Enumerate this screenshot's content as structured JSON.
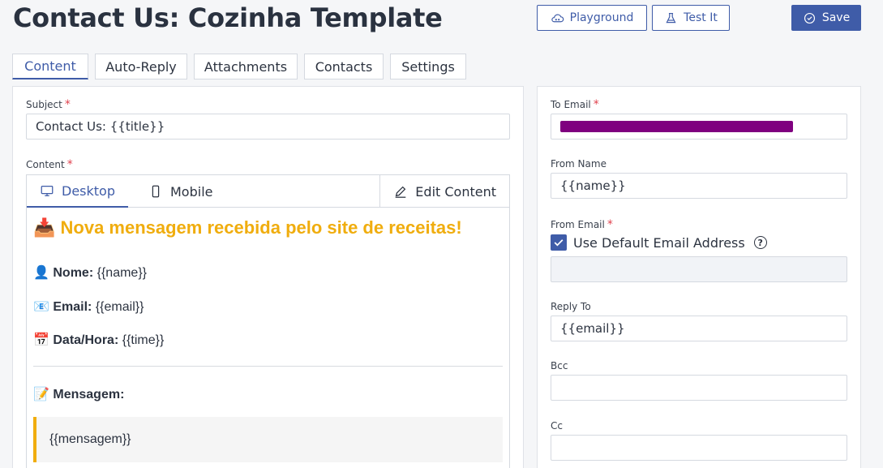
{
  "header": {
    "title": "Contact Us: Cozinha Template",
    "playground_label": "Playground",
    "test_label": "Test It",
    "save_label": "Save"
  },
  "tabs": [
    {
      "label": "Content",
      "active": true
    },
    {
      "label": "Auto-Reply"
    },
    {
      "label": "Attachments"
    },
    {
      "label": "Contacts"
    },
    {
      "label": "Settings"
    }
  ],
  "left": {
    "subject_label": "Subject",
    "subject_value": "Contact Us: {{title}}",
    "content_label": "Content",
    "editor_tabs": {
      "desktop": "Desktop",
      "mobile": "Mobile",
      "edit": "Edit Content"
    },
    "preview": {
      "heading": "📥 Nova mensagem recebida pelo site de receitas!",
      "name_key": "👤 Nome:",
      "name_val": " {{name}}",
      "email_key": "📧 Email:",
      "email_val": " {{email}}",
      "date_key": "📅 Data/Hora:",
      "date_val": " {{time}}",
      "msg_key": "📝 Mensagem:",
      "msg_val": "{{mensagem}}"
    }
  },
  "right": {
    "to_email_label": "To Email",
    "redaction_color": "#7f007f",
    "from_name_label": "From Name",
    "from_name_value": "{{name}}",
    "from_email_label": "From Email",
    "use_default_label": "Use Default Email Address",
    "use_default_checked": true,
    "from_email_value": "",
    "reply_to_label": "Reply To",
    "reply_to_value": "{{email}}",
    "bcc_label": "Bcc",
    "bcc_value": "",
    "cc_label": "Cc",
    "cc_value": ""
  },
  "colors": {
    "accent": "#3f5ca8",
    "heading": "#f0ad0e",
    "required": "#e0414d"
  }
}
